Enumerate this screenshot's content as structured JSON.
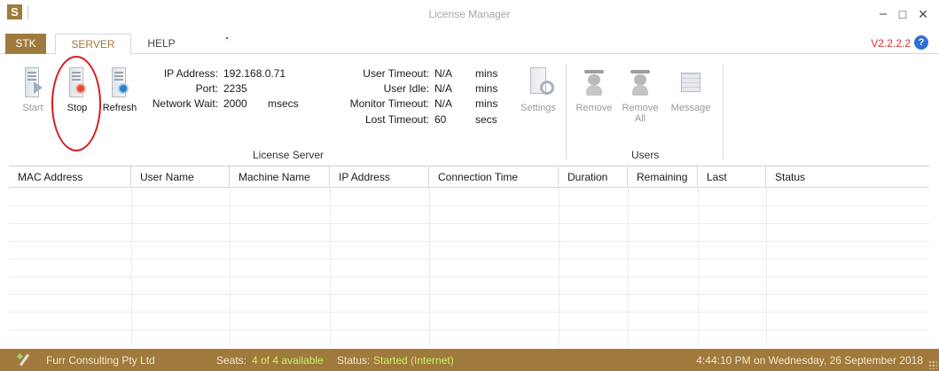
{
  "window": {
    "logo": "S",
    "title": "License Manager",
    "minimize": "–",
    "maximize": "□",
    "close": "×"
  },
  "tabs": [
    {
      "label": "STK"
    },
    {
      "label": "SERVER",
      "active": true
    },
    {
      "label": "HELP"
    }
  ],
  "version": "V2.2.2.2",
  "help_icon": "?",
  "ribbon": {
    "buttons": {
      "start": "Start",
      "stop": "Stop",
      "refresh": "Refresh",
      "settings": "Settings",
      "remove": "Remove",
      "remove_all_line1": "Remove",
      "remove_all_line2": "All",
      "message": "Message"
    },
    "server_info": {
      "ip_address_label": "IP Address:",
      "ip_address": "192.168.0.71",
      "port_label": "Port:",
      "port": "2235",
      "network_wait_label": "Network Wait:",
      "network_wait": "2000",
      "network_wait_unit": "msecs"
    },
    "timeouts": {
      "user_timeout_label": "User Timeout:",
      "user_timeout": "N/A",
      "user_timeout_unit": "mins",
      "user_idle_label": "User Idle:",
      "user_idle": "N/A",
      "user_idle_unit": "mins",
      "monitor_timeout_label": "Monitor Timeout:",
      "monitor_timeout": "N/A",
      "monitor_timeout_unit": "mins",
      "lost_timeout_label": "Lost Timeout:",
      "lost_timeout": "60",
      "lost_timeout_unit": "secs"
    },
    "groups": {
      "license_server": "License Server",
      "users": "Users"
    }
  },
  "table": {
    "columns": [
      "MAC Address",
      "User Name",
      "Machine Name",
      "IP Address",
      "Connection Time",
      "Duration",
      "Remaining",
      "Last",
      "Status"
    ],
    "rows": []
  },
  "statusbar": {
    "company": "Furr Consulting Pty Ltd",
    "seats_label": "Seats:",
    "seats_value": "4 of 4 available",
    "status_label": "Status:",
    "status_value": "Started (Internet)",
    "datetime": "4:44:10 PM on Wednesday, 26 September 2018"
  },
  "colors": {
    "accent": "#a07a3c",
    "version_red": "#e03030",
    "status_green": "#c6f26a",
    "highlight_circle": "#d61c1c"
  }
}
